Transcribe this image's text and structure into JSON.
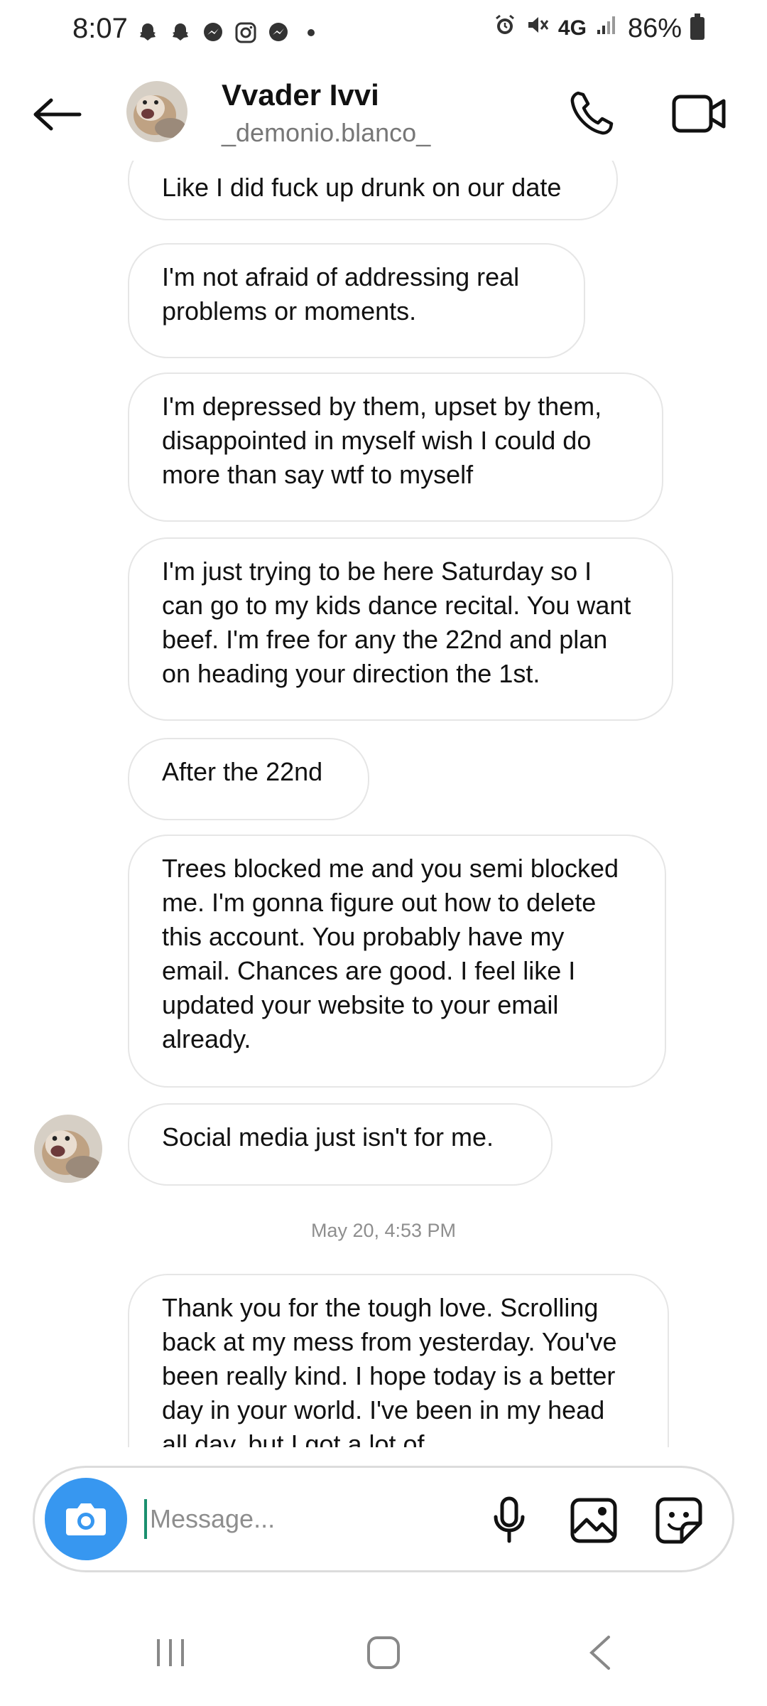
{
  "status_bar": {
    "time": "8:07",
    "left_icons": [
      "snapchat-icon",
      "snapchat-icon",
      "messenger-icon",
      "instagram-icon",
      "messenger-icon",
      "dot-icon"
    ],
    "right_icons": [
      "alarm-icon",
      "mute-icon",
      "signal-icon",
      "battery-icon"
    ],
    "network": "4G",
    "battery": "86%"
  },
  "header": {
    "name": "Vvader Ivvi",
    "username": "_demonio.blanco_"
  },
  "messages": [
    {
      "text": "Like I did fuck up drunk on our date"
    },
    {
      "text": "I'm not afraid of addressing real problems or moments."
    },
    {
      "text": "I'm depressed by them, upset by them, disappointed in myself wish I could do more than say wtf to myself"
    },
    {
      "text": "I'm just trying to be here Saturday so I can go to my kids dance recital. You want beef. I'm free for any the 22nd and plan on heading your direction the 1st."
    },
    {
      "text": "After the 22nd"
    },
    {
      "text": "Trees blocked me and you semi blocked me. I'm gonna figure out how to delete this account. You probably have my email. Chances are good. I feel like I updated your website to your email already."
    },
    {
      "text": "Social media just isn't for me."
    }
  ],
  "timestamp": "May 20, 4:53 PM",
  "messages_after": [
    {
      "text": "Thank you for the tough love. Scrolling back at my mess from yesterday. You've been really kind. I hope today is a better day in your world. I've been in my head all day, but I got a lot of"
    }
  ],
  "composer": {
    "placeholder": "Message..."
  },
  "colors": {
    "accent": "#3797f0",
    "bubble_border": "#e6e6e6",
    "muted_text": "#8e8e8e"
  }
}
